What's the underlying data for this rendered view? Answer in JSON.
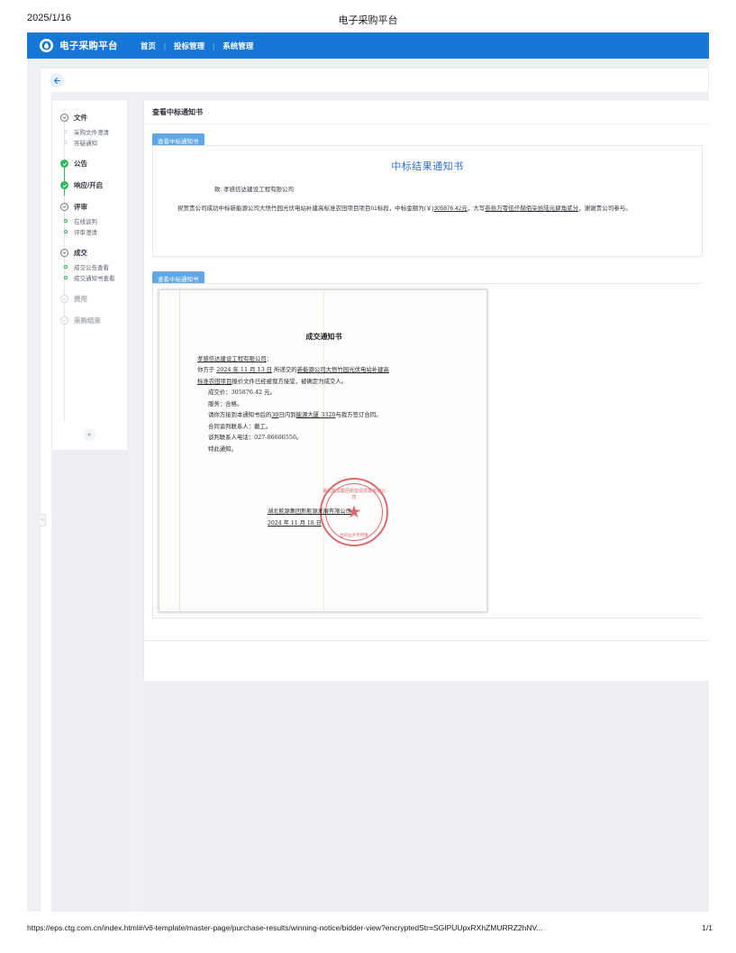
{
  "print": {
    "date": "2025/1/16",
    "title": "电子采购平台",
    "url": "https://eps.ctg.com.cn/index.html#/v6-template/master-page/purchase-results/winning-notice/bidder-view?encryptedStr=SGIPUUpxRXhZMURRZ2hNV...",
    "page": "1/1"
  },
  "topbar": {
    "brand": "电子采购平台",
    "nav": [
      {
        "label": "首页"
      },
      {
        "label": "投标管理"
      },
      {
        "label": "系统管理"
      }
    ],
    "separator": "|",
    "accent": "#1677d6"
  },
  "back_button": {
    "name": "返回"
  },
  "sidebar": {
    "collapse_label": "«",
    "edge_handle_label": "›",
    "steps": [
      {
        "label": "文件",
        "state": "open",
        "children": [
          {
            "label": "采购文件澄清",
            "state": "muted"
          },
          {
            "label": "答疑通知",
            "state": "muted"
          }
        ]
      },
      {
        "label": "公告",
        "state": "done",
        "children": []
      },
      {
        "label": "响应/开启",
        "state": "done",
        "children": []
      },
      {
        "label": "评审",
        "state": "open",
        "children": [
          {
            "label": "在线谈判",
            "state": "green"
          },
          {
            "label": "评审澄清",
            "state": "green"
          }
        ]
      },
      {
        "label": "成交",
        "state": "open",
        "children": [
          {
            "label": "成交公告查看",
            "state": "green"
          },
          {
            "label": "成交通知书查看",
            "state": "green"
          }
        ]
      },
      {
        "label": "费用",
        "state": "muted",
        "children": []
      },
      {
        "label": "采购结束",
        "state": "muted",
        "children": []
      }
    ]
  },
  "main": {
    "page_title": "查看中标通知书",
    "panels": [
      {
        "tab": "查看中标通知书"
      },
      {
        "tab": "查看中标通知书"
      }
    ]
  },
  "notice": {
    "heading": "中标结果通知书",
    "to_label": "致:",
    "to_company": "孝感信达建设工程有限公司",
    "body_pre": "祝贺贵公司成功中标新能源公司大悟竹园光伏电站补建高标准农田项目项目01标段，中标金额为(￥)",
    "amount": "305876.42元",
    "body_mid": "，大写",
    "amount_cn": "叁拾万零伍仟捌佰柒拾陆元肆角贰分",
    "body_post": "，谢谢贵公司参与。"
  },
  "pdf": {
    "title": "成交通知书",
    "addressee": "孝感信达建设工程有限公司",
    "addressee_suffix": "：",
    "line_you": "你方于",
    "date_submit": "2024 年 11 月 13 日",
    "line_submitted": "所递交的",
    "project": "新能源公司大悟竹园光伏电站补建高",
    "project2": "标准农田项目",
    "line_accept": "报价文件已经被我方接受，被确定为成交人。",
    "price_label": "成交价：",
    "price_value": "305876.42 元。",
    "service_label": "服务：",
    "service_value": "合格。",
    "sign_pre": "请你方接到本通知书后的",
    "sign_days": "30",
    "sign_mid": "日内到",
    "sign_place": "能源大厦 3320",
    "sign_post": "与我方签订合同。",
    "contact_label": "合同谈判联系人：",
    "contact_name": "戴工。",
    "phone_label": "谈判联系人电话：",
    "phone_value": "027-86606556。",
    "closing": "特此通知。",
    "seal_company": "湖北能源集团新能源发展有限公司",
    "seal_date": "2024 年 11 月 18 日",
    "seal_text_top": "湖北能源集团新能源发展有限公司",
    "seal_text_bottom": "合同业务专用章"
  }
}
